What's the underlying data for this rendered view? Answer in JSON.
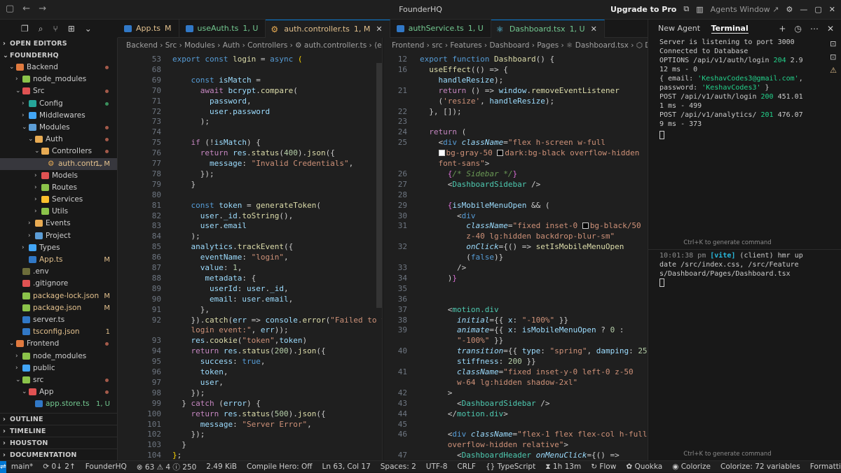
{
  "title": "FounderHQ",
  "titlebar": {
    "upgrade": "Upgrade to Pro",
    "agents": "Agents Window ↗"
  },
  "explorer": {
    "open_editors": "OPEN EDITORS",
    "project": "FOUNDERHQ",
    "items": [
      {
        "label": "Backend",
        "depth": 1,
        "kind": "folder-open",
        "status": "",
        "color": "#e07a3f",
        "mark": "dot"
      },
      {
        "label": "node_modules",
        "depth": 2,
        "kind": "folder",
        "status": "",
        "color": "#8bc34a"
      },
      {
        "label": "Src",
        "depth": 2,
        "kind": "folder-open",
        "status": "",
        "color": "#e05252",
        "mark": "dot"
      },
      {
        "label": "Config",
        "depth": 3,
        "kind": "folder",
        "status": "",
        "color": "#26a69a",
        "mark": "dot-green"
      },
      {
        "label": "Middlewares",
        "depth": 3,
        "kind": "folder",
        "status": "",
        "color": "#42a5f5"
      },
      {
        "label": "Modules",
        "depth": 3,
        "kind": "folder-open",
        "status": "",
        "color": "#5c9dd6",
        "mark": "dot"
      },
      {
        "label": "Auth",
        "depth": 4,
        "kind": "folder-open",
        "status": "",
        "color": "#e8ab53",
        "mark": "dot"
      },
      {
        "label": "Controllers",
        "depth": 5,
        "kind": "folder-open",
        "status": "",
        "color": "#e8ab53",
        "mark": "dot"
      },
      {
        "label": "auth.contr...",
        "depth": 6,
        "kind": "gear",
        "status": "1, M",
        "color": "#e8ab53",
        "selected": true
      },
      {
        "label": "Models",
        "depth": 5,
        "kind": "folder",
        "status": "",
        "color": "#e05252"
      },
      {
        "label": "Routes",
        "depth": 5,
        "kind": "folder",
        "status": "",
        "color": "#8bc34a"
      },
      {
        "label": "Services",
        "depth": 5,
        "kind": "folder",
        "status": "",
        "color": "#fbc02d"
      },
      {
        "label": "Utils",
        "depth": 5,
        "kind": "folder",
        "status": "",
        "color": "#8bc34a"
      },
      {
        "label": "Events",
        "depth": 4,
        "kind": "folder",
        "status": "",
        "color": "#e8ab53"
      },
      {
        "label": "Project",
        "depth": 4,
        "kind": "folder",
        "status": "",
        "color": "#5c9dd6"
      },
      {
        "label": "Types",
        "depth": 3,
        "kind": "folder",
        "status": "",
        "color": "#42a5f5"
      },
      {
        "label": "App.ts",
        "depth": 3,
        "kind": "ts",
        "status": "M",
        "color": "#3178c6"
      },
      {
        "label": ".env",
        "depth": 2,
        "kind": "file",
        "status": "",
        "color": "#6d6d3a"
      },
      {
        "label": ".gitignore",
        "depth": 2,
        "kind": "file",
        "status": "",
        "color": "#e05252"
      },
      {
        "label": "package-lock.json",
        "depth": 2,
        "kind": "file",
        "status": "M",
        "color": "#8bc34a"
      },
      {
        "label": "package.json",
        "depth": 2,
        "kind": "file",
        "status": "M",
        "color": "#8bc34a"
      },
      {
        "label": "server.ts",
        "depth": 2,
        "kind": "ts",
        "status": "",
        "color": "#3178c6"
      },
      {
        "label": "tsconfig.json",
        "depth": 2,
        "kind": "ts",
        "status": "1",
        "color": "#3178c6"
      },
      {
        "label": "Frontend",
        "depth": 1,
        "kind": "folder-open",
        "status": "",
        "color": "#e07a3f",
        "mark": "dot"
      },
      {
        "label": "node_modules",
        "depth": 2,
        "kind": "folder",
        "status": "",
        "color": "#8bc34a"
      },
      {
        "label": "public",
        "depth": 2,
        "kind": "folder",
        "status": "",
        "color": "#42a5f5"
      },
      {
        "label": "src",
        "depth": 2,
        "kind": "folder-open",
        "status": "",
        "color": "#8bc34a",
        "mark": "dot"
      },
      {
        "label": "App",
        "depth": 3,
        "kind": "folder-open",
        "status": "",
        "color": "#e05252",
        "mark": "dot"
      },
      {
        "label": "app.store.ts",
        "depth": 4,
        "kind": "ts",
        "status": "1, U",
        "color": "#3178c6"
      }
    ],
    "bottom_sections": [
      "OUTLINE",
      "TIMELINE",
      "HOUSTON",
      "DOCUMENTATION"
    ]
  },
  "tabs": [
    {
      "label": "App.ts",
      "mod": "M",
      "icon": "ts-icon"
    },
    {
      "label": "useAuth.ts",
      "mod": "1, U",
      "icon": "ts-icon"
    },
    {
      "label": "auth.controller.ts",
      "mod": "1, M",
      "icon": "gear-icon",
      "active": true
    },
    {
      "label": "authService.ts",
      "mod": "1, U",
      "icon": "ts-icon"
    },
    {
      "label": "Dashboard.tsx",
      "mod": "1, U",
      "icon": "react-icon",
      "active": true
    }
  ],
  "editor1": {
    "breadcrumb": "Backend › Src › Modules › Auth › Controllers › ⚙ auth.controller.ts › ⟨e⟩ login",
    "lines": [
      {
        "n": "53",
        "h": "<span class=kw>export</span> <span class=kw>const</span> <span class=fn>login</span> = <span class=kw>async</span> <span class=pr>(</span>"
      },
      {
        "n": "68",
        "h": ""
      },
      {
        "n": "69",
        "h": "    <span class=kw>const</span> <span class=vr>isMatch</span> ="
      },
      {
        "n": "70",
        "h": "      <span class=kc>await</span> <span class=vr>bcrypt</span>.<span class=fn>compare</span>("
      },
      {
        "n": "71",
        "h": "        <span class=vr>password</span>,"
      },
      {
        "n": "72",
        "h": "        <span class=vr>user</span>.<span class=vr>password</span>"
      },
      {
        "n": "73",
        "h": "      );"
      },
      {
        "n": "74",
        "h": ""
      },
      {
        "n": "75",
        "h": "    <span class=kc>if</span> (!<span class=vr>isMatch</span>) {"
      },
      {
        "n": "76",
        "h": "      <span class=kc>return</span> <span class=vr>res</span>.<span class=fn>status</span>(<span class=num>400</span>).<span class=fn>json</span>({"
      },
      {
        "n": "77",
        "h": "        <span class=vr>message</span>: <span class=str>\"Invalid Credentials\"</span>,"
      },
      {
        "n": "78",
        "h": "      });"
      },
      {
        "n": "79",
        "h": "    }"
      },
      {
        "n": "80",
        "h": ""
      },
      {
        "n": "81",
        "h": "    <span class=kw>const</span> <span class=vr>token</span> = <span class=fn>generateToken</span>("
      },
      {
        "n": "82",
        "h": "      <span class=vr>user</span>.<span class=vr>_id</span>.<span class=fn>toString</span>(),"
      },
      {
        "n": "83",
        "h": "      <span class=vr>user</span>.<span class=vr>email</span>"
      },
      {
        "n": "84",
        "h": "    );"
      },
      {
        "n": "85",
        "h": "    <span class=vr>analytics</span>.<span class=fn>trackEvent</span>({"
      },
      {
        "n": "86",
        "h": "      <span class=vr>eventName</span>: <span class=str>\"login\"</span>,"
      },
      {
        "n": "87",
        "h": "      <span class=vr>value</span>: <span class=num>1</span>,"
      },
      {
        "n": "88",
        "h": "       <span class=vr>metadata</span>: {"
      },
      {
        "n": "89",
        "h": "        <span class=vr>userId</span>: <span class=vr>user</span>.<span class=vr>_id</span>,"
      },
      {
        "n": "90",
        "h": "        <span class=vr>email</span>: <span class=vr>user</span>.<span class=vr>email</span>,"
      },
      {
        "n": "91",
        "h": "      },"
      },
      {
        "n": "92",
        "h": "    }).<span class=fn>catch</span>(<span class=vr>err</span> => <span class=vr>console</span>.<span class=fn>error</span>(<span class=str>\"Failed to track</span>"
      },
      {
        "n": "",
        "h": "    <span class=str>login event:\"</span>, <span class=vr>err</span>));"
      },
      {
        "n": "93",
        "h": "    <span class=vr>res</span>.<span class=fn>cookie</span>(<span class=str>\"token\"</span>,<span class=vr>token</span>)"
      },
      {
        "n": "94",
        "h": "    <span class=kc>return</span> <span class=vr>res</span>.<span class=fn>status</span>(<span class=num>200</span>).<span class=fn>json</span>({"
      },
      {
        "n": "95",
        "h": "      <span class=vr>success</span>: <span class=kw>true</span>,"
      },
      {
        "n": "96",
        "h": "      <span class=vr>token</span>,"
      },
      {
        "n": "97",
        "h": "      <span class=vr>user</span>,"
      },
      {
        "n": "98",
        "h": "    });"
      },
      {
        "n": "99",
        "h": "  } <span class=kc>catch</span> (<span class=vr>error</span>) {"
      },
      {
        "n": "100",
        "h": "    <span class=kc>return</span> <span class=vr>res</span>.<span class=fn>status</span>(<span class=num>500</span>).<span class=fn>json</span>({"
      },
      {
        "n": "101",
        "h": "      <span class=vr>message</span>: <span class=str>\"Server Error\"</span>,"
      },
      {
        "n": "102",
        "h": "    });"
      },
      {
        "n": "103",
        "h": "  }"
      },
      {
        "n": "104",
        "h": "<span class=pr>}</span>;"
      }
    ]
  },
  "editor2": {
    "breadcrumb": "Frontend › src › Features › Dashboard › Pages › ⚛ Dashboard.tsx › ⬡ Dashb",
    "lines": [
      {
        "n": "12",
        "h": "<span class=kw>export</span> <span class=kw>function</span> <span class=fn>Dashboard</span>() {"
      },
      {
        "n": "16",
        "h": "  <span class=fn>useEffect</span>(() => {"
      },
      {
        "n": "",
        "h": "    <span class=vr>handleResize</span>);"
      },
      {
        "n": "21",
        "h": "    <span class=kc>return</span> () => <span class=vr>window</span>.<span class=fn>removeEventListener</span>"
      },
      {
        "n": "",
        "h": "    (<span class=str>'resize'</span>, <span class=vr>handleResize</span>);"
      },
      {
        "n": "22",
        "h": "  }, []);"
      },
      {
        "n": "23",
        "h": ""
      },
      {
        "n": "24",
        "h": "  <span class=kc>return</span> ("
      },
      {
        "n": "25",
        "h": "    &lt;<span class=kw>div</span> <span class=at>className</span>=<span class=str>\"flex h-screen w-full</span>"
      },
      {
        "n": "",
        "h": "    <span class=swatch style=background:#f9fafb></span><span class=str>bg-gray-50</span> <span class=swatch style=background:#000></span><span class=str>dark:bg-black overflow-hidden</span>"
      },
      {
        "n": "",
        "h": "    <span class=str>font-sans\"</span>&gt;"
      },
      {
        "n": "26",
        "h": "      <span class=br>{</span><span class=cm>/* Sidebar */</span><span class=br>}</span>"
      },
      {
        "n": "27",
        "h": "      &lt;<span class=tg>DashboardSidebar</span> /&gt;"
      },
      {
        "n": "28",
        "h": ""
      },
      {
        "n": "29",
        "h": "      <span class=br>{</span><span class=vr>isMobileMenuOpen</span> &amp;&amp; ("
      },
      {
        "n": "30",
        "h": "        &lt;<span class=kw>div</span>"
      },
      {
        "n": "31",
        "h": "          <span class=at>className</span>=<span class=str>\"fixed inset-0 </span><span class=swatch style=background:#000></span><span class=str>bg-black/50</span>"
      },
      {
        "n": "",
        "h": "          <span class=str>z-40 lg:hidden backdrop-blur-sm\"</span>"
      },
      {
        "n": "32",
        "h": "          <span class=at>onClick</span>={() => <span class=fn>setIsMobileMenuOpen</span>"
      },
      {
        "n": "",
        "h": "          (<span class=kw>false</span>)}"
      },
      {
        "n": "33",
        "h": "        /&gt;"
      },
      {
        "n": "34",
        "h": "      )<span class=br>}</span>"
      },
      {
        "n": "35",
        "h": ""
      },
      {
        "n": "36",
        "h": ""
      },
      {
        "n": "37",
        "h": "      &lt;<span class=tg>motion.div</span>"
      },
      {
        "n": "38",
        "h": "        <span class=at>initial</span>={{ <span class=vr>x</span>: <span class=str>\"-100%\"</span> }}"
      },
      {
        "n": "39",
        "h": "        <span class=at>animate</span>={{ <span class=vr>x</span>: <span class=vr>isMobileMenuOpen</span> ? <span class=num>0</span> :"
      },
      {
        "n": "",
        "h": "        <span class=str>\"-100%\"</span> }}"
      },
      {
        "n": "40",
        "h": "        <span class=at>transition</span>={{ <span class=vr>type</span>: <span class=str>\"spring\"</span>, <span class=vr>damping</span>: <span class=num>25</span>,"
      },
      {
        "n": "",
        "h": "        <span class=vr>stiffness</span>: <span class=num>200</span> }}"
      },
      {
        "n": "41",
        "h": "        <span class=at>className</span>=<span class=str>\"fixed inset-y-0 left-0 z-50</span>"
      },
      {
        "n": "",
        "h": "        <span class=str>w-64 lg:hidden shadow-2xl\"</span>"
      },
      {
        "n": "42",
        "h": "      &gt;"
      },
      {
        "n": "43",
        "h": "        &lt;<span class=tg>DashboardSidebar</span> /&gt;"
      },
      {
        "n": "44",
        "h": "      &lt;/<span class=tg>motion.div</span>&gt;"
      },
      {
        "n": "45",
        "h": ""
      },
      {
        "n": "46",
        "h": "      &lt;<span class=kw>div</span> <span class=at>className</span>=<span class=str>\"flex-1 flex flex-col h-full</span>"
      },
      {
        "n": "",
        "h": "      <span class=str>overflow-hidden relative\"</span>&gt;"
      },
      {
        "n": "47",
        "h": "        &lt;<span class=tg>DashboardHeader</span> <span class=at>onMenuClick</span>={() =>"
      }
    ]
  },
  "terminal": {
    "tab_agent": "New Agent",
    "tab_terminal": "Terminal",
    "lines": [
      "Server is listening to port 3000",
      "Connected to Database",
      "OPTIONS /api/v1/auth/login <span class=g>204</span> 2.912 ms - 0",
      "{ email: <span class=g>'KeshavCodes3@gmail.com'</span>, password: <span class=g>'KeshavCodes3'</span> }",
      "POST /api/v1/auth/login <span class=g>200</span> 451.011 ms - 499",
      "POST /api/v1/analytics/ <span class=g>201</span> 476.079 ms - 373"
    ],
    "hint": "Ctrl+K to generate command",
    "vite_time": "10:01:38 pm",
    "vite_tag": "[vite]",
    "vite_msg": "(client) hmr update /src/index.css, /src/Features/Dashboard/Pages/Dashboard.tsx",
    "hint2": "Ctrl+K to generate command"
  },
  "statusbar": {
    "branch": "main*",
    "sync": "⟳ 0↓ 2↑",
    "project": "FounderHQ",
    "problems": "⊗ 63 ⚠ 4 ⓘ 250",
    "size": "2.49 KiB",
    "compile": "Compile Hero: Off",
    "position": "Ln 63, Col 17",
    "spaces": "Spaces: 2",
    "encoding": "UTF-8",
    "eol": "CRLF",
    "language": "{} TypeScript",
    "time": "⧗ 1h 13m",
    "flow": "↻ Flow",
    "quokka": "✿ Quokka",
    "colorize": "◉ Colorize",
    "colorize_vars": "Colorize: 72 variables",
    "formatting": "Formatting: ✓"
  }
}
